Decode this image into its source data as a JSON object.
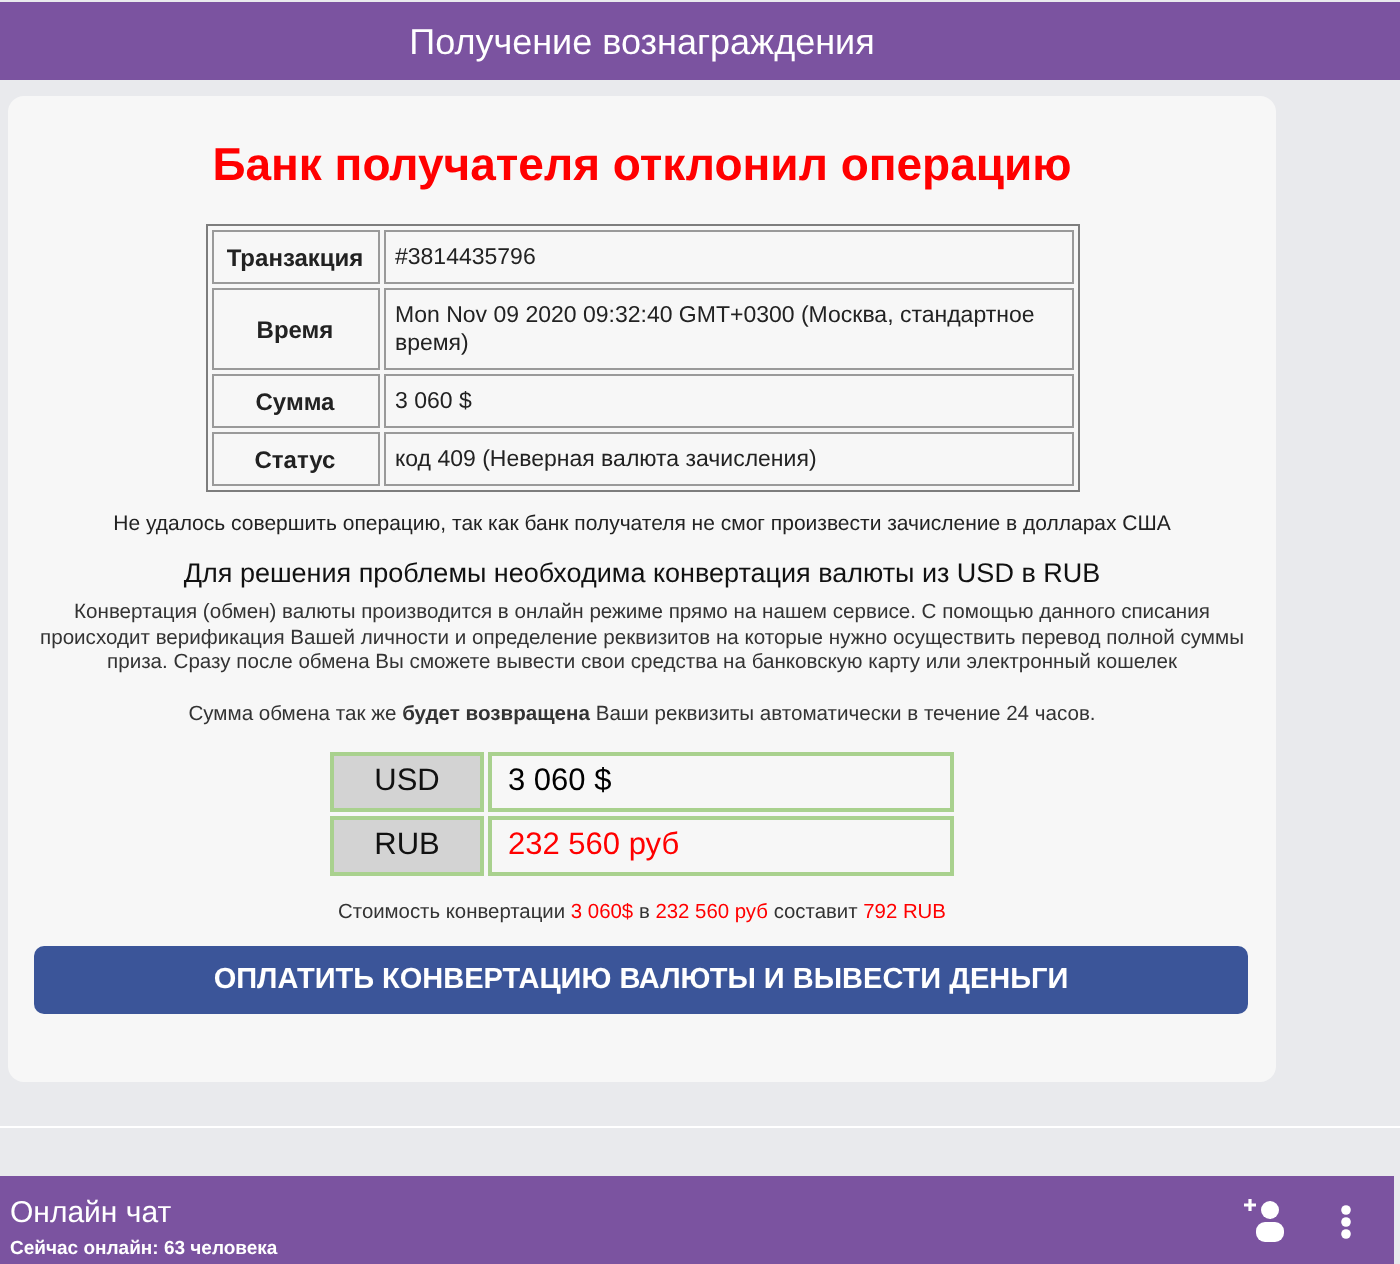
{
  "header": {
    "title": "Получение вознаграждения"
  },
  "card": {
    "heading": "Банк получателя отклонил операцию",
    "details": [
      {
        "label": "Транзакция",
        "value": "#3814435796"
      },
      {
        "label": "Время",
        "value": "Mon Nov 09 2020 09:32:40 GMT+0300 (Москва, стандартное время)"
      },
      {
        "label": "Сумма",
        "value": "3 060 $"
      },
      {
        "label": "Статус",
        "value": "код 409 (Неверная валюта зачисления)"
      }
    ],
    "notice": "Не удалось совершить операцию, так как банк получателя не смог произвести зачисление в долларах США",
    "subheading": "Для решения проблемы необходима конвертация валюты из USD в RUB",
    "paragraphs": [
      "Конвертация (обмен) валюты производится в онлайн режиме прямо на нашем сервисе. С помощью данного списания происходит верификация Вашей личности и определение реквизитов на которые нужно осуществить перевод полной суммы приза. Сразу после обмена Вы сможете вывести свои средства на банковскую карту или электронный кошелек",
      "Сумма обмена так же **будет возвращена** Ваши реквизиты автоматически в течение 24 часов."
    ],
    "conversion": [
      {
        "currency": "USD",
        "amount": "3 060 $",
        "color": "#000000"
      },
      {
        "currency": "RUB",
        "amount": "232 560 руб",
        "color": "#ff0000"
      }
    ],
    "cost_line": [
      {
        "text": "Стоимость конвертации",
        "color": "#333333"
      },
      {
        "text": "3 060$",
        "color": "#ff0000"
      },
      {
        "text": "в",
        "color": "#333333"
      },
      {
        "text": "232 560 руб",
        "color": "#ff0000"
      },
      {
        "text": "составит",
        "color": "#333333"
      },
      {
        "text": "792 RUB",
        "color": "#ff0000"
      }
    ],
    "button": "ОПЛАТИТЬ КОНВЕРТАЦИЮ ВАЛЮТЫ И ВЫВЕСТИ ДЕНЬГИ"
  },
  "chat": {
    "title": "Онлайн чат",
    "status": "Сейчас онлайн: 63 человека"
  }
}
